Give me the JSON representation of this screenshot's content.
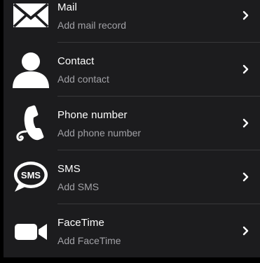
{
  "colors": {
    "background": "#000000",
    "panel": "#1c1c1e",
    "divider": "#38383a",
    "title": "#ffffff",
    "subtitle": "#a1a1a6",
    "icon": "#ffffff"
  },
  "items": [
    {
      "icon": "mail-icon",
      "title": "Mail",
      "subtitle": "Add mail record"
    },
    {
      "icon": "person-icon",
      "title": "Contact",
      "subtitle": "Add contact"
    },
    {
      "icon": "phone-icon",
      "title": "Phone number",
      "subtitle": "Add phone number"
    },
    {
      "icon": "sms-icon",
      "title": "SMS",
      "subtitle": "Add SMS"
    },
    {
      "icon": "facetime-icon",
      "title": "FaceTime",
      "subtitle": "Add FaceTime"
    }
  ],
  "chevron_icon": "chevron-right-icon"
}
